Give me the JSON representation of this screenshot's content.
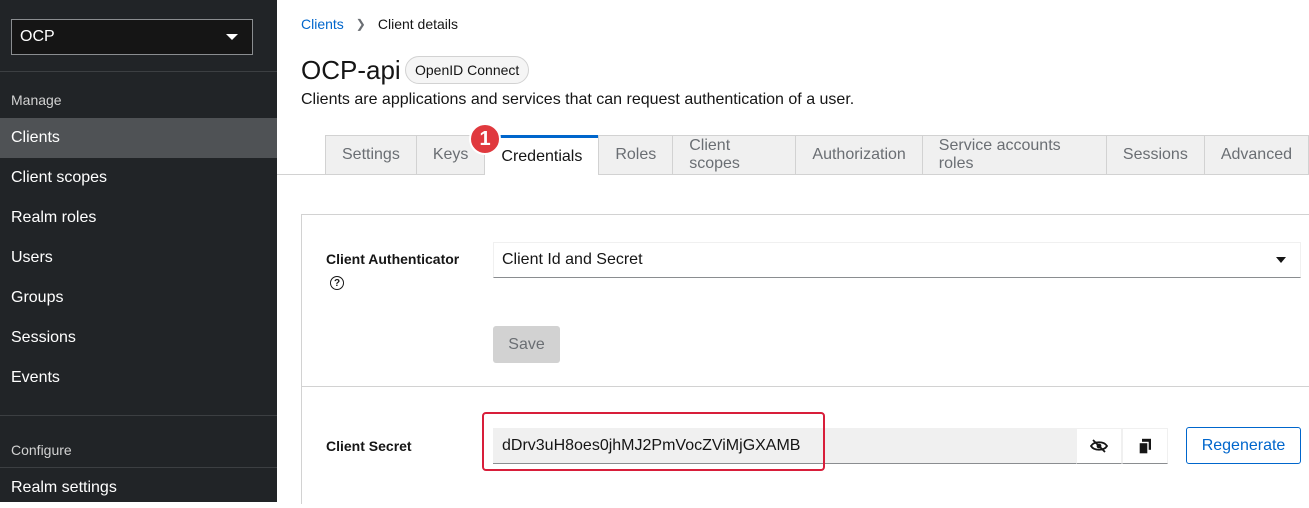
{
  "sidebar": {
    "realm": "OCP",
    "sections": {
      "manage": "Manage",
      "configure": "Configure"
    },
    "items": [
      {
        "label": "Clients",
        "active": true
      },
      {
        "label": "Client scopes"
      },
      {
        "label": "Realm roles"
      },
      {
        "label": "Users"
      },
      {
        "label": "Groups"
      },
      {
        "label": "Sessions"
      },
      {
        "label": "Events"
      }
    ],
    "configure_items": [
      {
        "label": "Realm settings"
      }
    ]
  },
  "breadcrumb": {
    "clients": "Clients",
    "current": "Client details"
  },
  "header": {
    "title": "OCP-api",
    "protocol": "OpenID Connect",
    "description": "Clients are applications and services that can request authentication of a user."
  },
  "tabs": [
    "Settings",
    "Keys",
    "Credentials",
    "Roles",
    "Client scopes",
    "Authorization",
    "Service accounts roles",
    "Sessions",
    "Advanced"
  ],
  "active_tab": "Credentials",
  "step_badge": "1",
  "credentials": {
    "authenticator_label": "Client Authenticator",
    "authenticator_value": "Client Id and Secret",
    "save_label": "Save",
    "secret_label": "Client Secret",
    "secret_value": "dDrv3uH8oes0jhMJ2PmVocZViMjGXAMB",
    "regenerate_label": "Regenerate"
  },
  "colors": {
    "accent": "#0066cc",
    "sidebar_bg": "#212427",
    "highlight": "#d81e3a",
    "badge": "#e0393e"
  }
}
